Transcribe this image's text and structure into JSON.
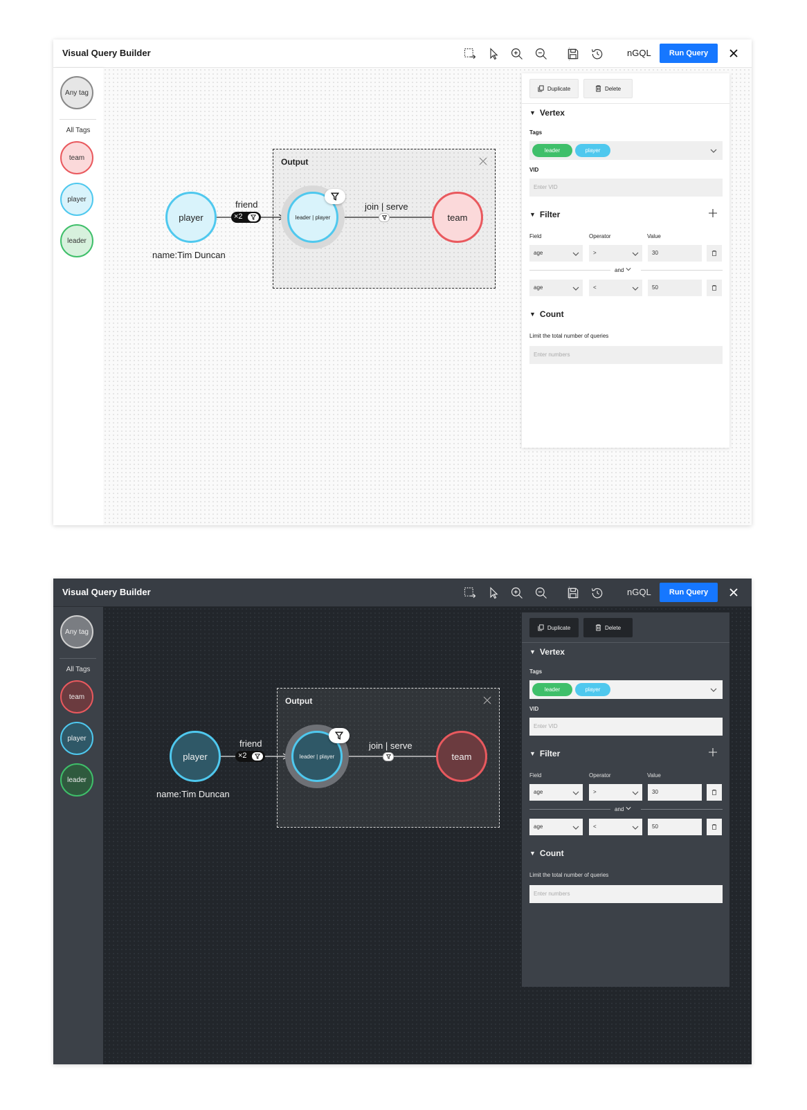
{
  "app": {
    "title": "Visual Query Builder",
    "ngql_label": "nGQL",
    "run_label": "Run Query",
    "toolbar_icons": [
      "box-select-icon",
      "pointer-icon",
      "zoom-in-icon",
      "zoom-out-icon",
      "save-icon",
      "history-icon"
    ]
  },
  "sidebar": {
    "any_tag": "Any tag",
    "all_tags_label": "All Tags",
    "tags": [
      {
        "label": "team",
        "color": "#e9595e"
      },
      {
        "label": "player",
        "color": "#4fc8ee"
      },
      {
        "label": "leader",
        "color": "#3fbf6a"
      }
    ]
  },
  "graph": {
    "source_node": {
      "label": "player",
      "caption": "name:Tim Duncan"
    },
    "edge1": {
      "label": "friend",
      "hops": "×2"
    },
    "output": {
      "title": "Output"
    },
    "output_node": {
      "label": "leader | player"
    },
    "edge2": {
      "label": "join | serve"
    },
    "target_node": {
      "label": "team"
    }
  },
  "panel": {
    "duplicate_label": "Duplicate",
    "delete_label": "Delete",
    "vertex": {
      "title": "Vertex",
      "tags_label": "Tags",
      "tags": [
        {
          "label": "leader",
          "color": "#3fbf6a"
        },
        {
          "label": "player",
          "color": "#4fc8ee"
        }
      ],
      "vid_label": "VID",
      "vid_placeholder": "Enter VID"
    },
    "filter": {
      "title": "Filter",
      "field_label": "Field",
      "operator_label": "Operator",
      "value_label": "Value",
      "rows": [
        {
          "field": "age",
          "operator": ">",
          "value": "30"
        },
        {
          "field": "age",
          "operator": "<",
          "value": "50"
        }
      ],
      "conjunction": "and"
    },
    "count": {
      "title": "Count",
      "hint": "Limit the total number of queries",
      "placeholder": "Enter numbers"
    }
  },
  "theme": {
    "accent": "#1677ff",
    "light_bg": "#ffffff",
    "dark_bg": "#282c31"
  }
}
